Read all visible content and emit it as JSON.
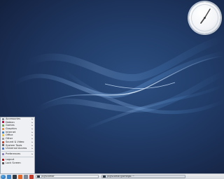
{
  "desktop": {
    "colors": {
      "background": "#1f3a66",
      "swirl": "#9cc9ff",
      "accent": "#3aa0e8"
    }
  },
  "clock_widget": {
    "icon": "analog-clock"
  },
  "app_menu": {
    "items": [
      {
        "label": "Accessories",
        "icon": "accessories-icon",
        "color": "#7b8794",
        "submenu": true
      },
      {
        "label": "Debian",
        "icon": "debian-icon",
        "color": "#c7053d",
        "submenu": true
      },
      {
        "label": "Games",
        "icon": "games-icon",
        "color": "#6aa84f",
        "submenu": true
      },
      {
        "label": "Graphics",
        "icon": "graphics-icon",
        "color": "#e69138",
        "submenu": true
      },
      {
        "label": "Internet",
        "icon": "internet-icon",
        "color": "#3d85c6",
        "submenu": true
      },
      {
        "label": "Office",
        "icon": "office-icon",
        "color": "#f1c232",
        "submenu": true
      },
      {
        "label": "Other",
        "icon": "other-icon",
        "color": "#999999",
        "submenu": true
      },
      {
        "label": "Sound & Video",
        "icon": "sound-video-icon",
        "color": "#cc4125",
        "submenu": true
      },
      {
        "label": "System Tools",
        "icon": "system-tools-icon",
        "color": "#666666",
        "submenu": true
      },
      {
        "label": "Universal Access",
        "icon": "universal-access-icon",
        "color": "#3c78d8",
        "submenu": true
      }
    ],
    "preferences": {
      "label": "Preferences",
      "icon": "preferences-icon",
      "color": "#8e7cc3",
      "submenu": true
    },
    "footer": [
      {
        "label": "Logout",
        "icon": "logout-icon",
        "color": "#cc0000"
      },
      {
        "label": "Lock Screen",
        "icon": "lock-screen-icon",
        "color": "#555555"
      }
    ]
  },
  "panel": {
    "taskbar": [
      {
        "label": "jk@scomar",
        "icon": "terminal-icon"
      },
      {
        "label": "jk@scomar@omega: ~",
        "icon": "terminal-icon"
      }
    ],
    "tray_text": "",
    "launchers": [
      {
        "icon": "file-manager-icon",
        "color": "#3d85c6"
      },
      {
        "icon": "terminal-launcher-icon",
        "color": "#2d3a45"
      },
      {
        "icon": "web-browser-icon",
        "color": "#e0662a"
      }
    ]
  }
}
